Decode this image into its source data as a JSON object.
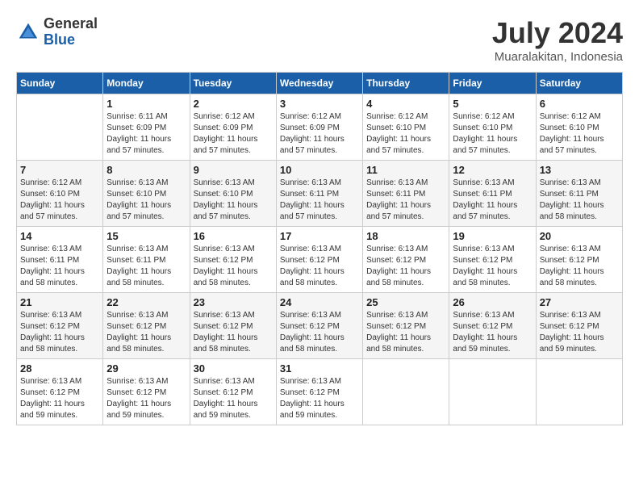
{
  "header": {
    "logo_general": "General",
    "logo_blue": "Blue",
    "month_year": "July 2024",
    "location": "Muaralakitan, Indonesia"
  },
  "days_of_week": [
    "Sunday",
    "Monday",
    "Tuesday",
    "Wednesday",
    "Thursday",
    "Friday",
    "Saturday"
  ],
  "weeks": [
    [
      {
        "day": "",
        "info": ""
      },
      {
        "day": "1",
        "info": "Sunrise: 6:11 AM\nSunset: 6:09 PM\nDaylight: 11 hours\nand 57 minutes."
      },
      {
        "day": "2",
        "info": "Sunrise: 6:12 AM\nSunset: 6:09 PM\nDaylight: 11 hours\nand 57 minutes."
      },
      {
        "day": "3",
        "info": "Sunrise: 6:12 AM\nSunset: 6:09 PM\nDaylight: 11 hours\nand 57 minutes."
      },
      {
        "day": "4",
        "info": "Sunrise: 6:12 AM\nSunset: 6:10 PM\nDaylight: 11 hours\nand 57 minutes."
      },
      {
        "day": "5",
        "info": "Sunrise: 6:12 AM\nSunset: 6:10 PM\nDaylight: 11 hours\nand 57 minutes."
      },
      {
        "day": "6",
        "info": "Sunrise: 6:12 AM\nSunset: 6:10 PM\nDaylight: 11 hours\nand 57 minutes."
      }
    ],
    [
      {
        "day": "7",
        "info": "Sunrise: 6:12 AM\nSunset: 6:10 PM\nDaylight: 11 hours\nand 57 minutes."
      },
      {
        "day": "8",
        "info": "Sunrise: 6:13 AM\nSunset: 6:10 PM\nDaylight: 11 hours\nand 57 minutes."
      },
      {
        "day": "9",
        "info": "Sunrise: 6:13 AM\nSunset: 6:10 PM\nDaylight: 11 hours\nand 57 minutes."
      },
      {
        "day": "10",
        "info": "Sunrise: 6:13 AM\nSunset: 6:11 PM\nDaylight: 11 hours\nand 57 minutes."
      },
      {
        "day": "11",
        "info": "Sunrise: 6:13 AM\nSunset: 6:11 PM\nDaylight: 11 hours\nand 57 minutes."
      },
      {
        "day": "12",
        "info": "Sunrise: 6:13 AM\nSunset: 6:11 PM\nDaylight: 11 hours\nand 57 minutes."
      },
      {
        "day": "13",
        "info": "Sunrise: 6:13 AM\nSunset: 6:11 PM\nDaylight: 11 hours\nand 58 minutes."
      }
    ],
    [
      {
        "day": "14",
        "info": "Sunrise: 6:13 AM\nSunset: 6:11 PM\nDaylight: 11 hours\nand 58 minutes."
      },
      {
        "day": "15",
        "info": "Sunrise: 6:13 AM\nSunset: 6:11 PM\nDaylight: 11 hours\nand 58 minutes."
      },
      {
        "day": "16",
        "info": "Sunrise: 6:13 AM\nSunset: 6:12 PM\nDaylight: 11 hours\nand 58 minutes."
      },
      {
        "day": "17",
        "info": "Sunrise: 6:13 AM\nSunset: 6:12 PM\nDaylight: 11 hours\nand 58 minutes."
      },
      {
        "day": "18",
        "info": "Sunrise: 6:13 AM\nSunset: 6:12 PM\nDaylight: 11 hours\nand 58 minutes."
      },
      {
        "day": "19",
        "info": "Sunrise: 6:13 AM\nSunset: 6:12 PM\nDaylight: 11 hours\nand 58 minutes."
      },
      {
        "day": "20",
        "info": "Sunrise: 6:13 AM\nSunset: 6:12 PM\nDaylight: 11 hours\nand 58 minutes."
      }
    ],
    [
      {
        "day": "21",
        "info": "Sunrise: 6:13 AM\nSunset: 6:12 PM\nDaylight: 11 hours\nand 58 minutes."
      },
      {
        "day": "22",
        "info": "Sunrise: 6:13 AM\nSunset: 6:12 PM\nDaylight: 11 hours\nand 58 minutes."
      },
      {
        "day": "23",
        "info": "Sunrise: 6:13 AM\nSunset: 6:12 PM\nDaylight: 11 hours\nand 58 minutes."
      },
      {
        "day": "24",
        "info": "Sunrise: 6:13 AM\nSunset: 6:12 PM\nDaylight: 11 hours\nand 58 minutes."
      },
      {
        "day": "25",
        "info": "Sunrise: 6:13 AM\nSunset: 6:12 PM\nDaylight: 11 hours\nand 58 minutes."
      },
      {
        "day": "26",
        "info": "Sunrise: 6:13 AM\nSunset: 6:12 PM\nDaylight: 11 hours\nand 59 minutes."
      },
      {
        "day": "27",
        "info": "Sunrise: 6:13 AM\nSunset: 6:12 PM\nDaylight: 11 hours\nand 59 minutes."
      }
    ],
    [
      {
        "day": "28",
        "info": "Sunrise: 6:13 AM\nSunset: 6:12 PM\nDaylight: 11 hours\nand 59 minutes."
      },
      {
        "day": "29",
        "info": "Sunrise: 6:13 AM\nSunset: 6:12 PM\nDaylight: 11 hours\nand 59 minutes."
      },
      {
        "day": "30",
        "info": "Sunrise: 6:13 AM\nSunset: 6:12 PM\nDaylight: 11 hours\nand 59 minutes."
      },
      {
        "day": "31",
        "info": "Sunrise: 6:13 AM\nSunset: 6:12 PM\nDaylight: 11 hours\nand 59 minutes."
      },
      {
        "day": "",
        "info": ""
      },
      {
        "day": "",
        "info": ""
      },
      {
        "day": "",
        "info": ""
      }
    ]
  ]
}
